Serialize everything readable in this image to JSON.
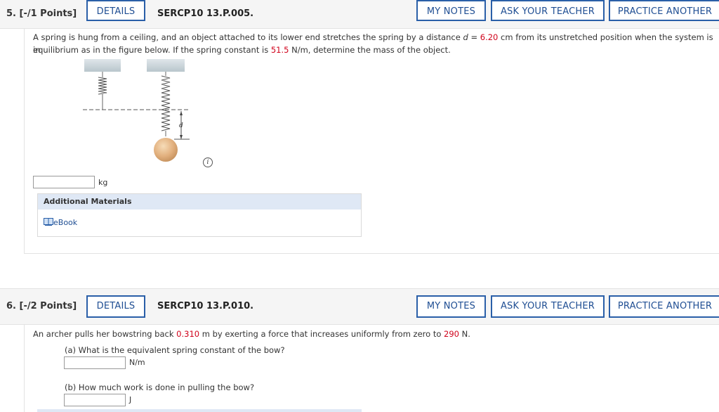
{
  "q5": {
    "number": "5.",
    "points": "[-/1 Points]",
    "details": "DETAILS",
    "code": "SERCP10 13.P.005.",
    "my_notes": "MY NOTES",
    "ask_teacher": "ASK YOUR TEACHER",
    "practice": "PRACTICE ANOTHER",
    "text_line1_a": "A spring is hung from a ceiling, and an object attached to its lower end stretches the spring by a distance ",
    "text_d": "d",
    "text_eq": " = ",
    "distance": "6.20",
    "text_line1_b": " cm from its unstretched position when the system is in",
    "text_line2_a": "equilibrium as in the figure below. If the spring constant is ",
    "spring_constant": "51.5",
    "text_line2_b": " N/m, determine the mass of the object.",
    "figure_label_d": "d",
    "unit": "kg",
    "additional_materials": "Additional Materials",
    "ebook": "eBook"
  },
  "q6": {
    "number": "6.",
    "points": "[-/2 Points]",
    "details": "DETAILS",
    "code": "SERCP10 13.P.010.",
    "my_notes": "MY NOTES",
    "ask_teacher": "ASK YOUR TEACHER",
    "practice": "PRACTICE ANOTHER",
    "text_a": "An archer pulls her bowstring back ",
    "distance": "0.310",
    "text_b": " m by exerting a force that increases uniformly from zero to ",
    "force": "290",
    "text_c": " N.",
    "part_a": "(a) What is the equivalent spring constant of the bow?",
    "unit_a": "N/m",
    "part_b": "(b) How much work is done in pulling the bow?",
    "unit_b": "J"
  },
  "colors": {
    "accent": "#2a5fa8",
    "highlight": "#d0021b",
    "header_bg": "#f5f5f5"
  }
}
